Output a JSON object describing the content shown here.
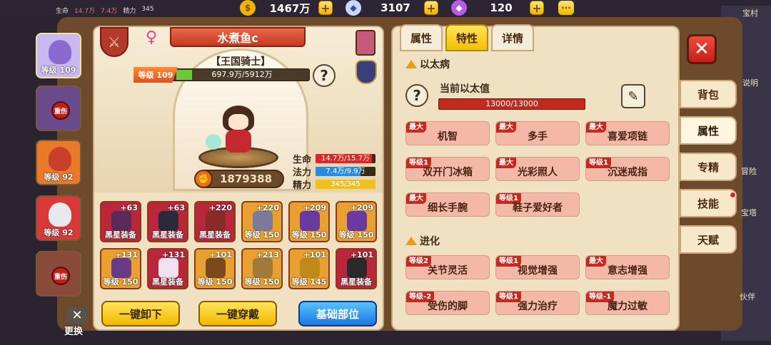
{
  "currency": {
    "gold": "1467万",
    "diamond": "3107",
    "gem": "120",
    "plus_label": "+",
    "more_label": "···",
    "gold_icon": "gold-coin-icon",
    "diamond_icon": "diamond-icon",
    "gem_icon": "purple-gem-icon"
  },
  "peek_stats": {
    "hp_label": "生命",
    "hp": "14.7万",
    "mp": "7.4万",
    "energy_label": "精力",
    "energy": "345"
  },
  "right_edge_texts": [
    "宝村",
    "说明",
    "冒险",
    "宝塔",
    "伙伴"
  ],
  "roster": [
    {
      "level": "等级 109",
      "state": "selected",
      "color": "#c9b8f0"
    },
    {
      "level": "",
      "state": "重伤",
      "color": "#6a4a8a"
    },
    {
      "level": "等级 92",
      "state": "normal",
      "color": "#e87a2a"
    },
    {
      "level": "等级 92",
      "state": "normal",
      "color": "#d83a3a"
    },
    {
      "level": "",
      "state": "重伤",
      "color": "#8a4a3a"
    }
  ],
  "swap_label": "更换",
  "hero": {
    "name": "水煮鱼c",
    "title": "【王国骑士】",
    "level_tag": "等级 109",
    "exp_text": "697.9万/5912万",
    "exp_fraction": 0.118,
    "power": "1879388",
    "help": "?",
    "stats": [
      {
        "label": "生命",
        "value": "14.7万/15.7万",
        "fraction": 0.936,
        "color": "#d8282a"
      },
      {
        "label": "法力",
        "value": "7.4万/9.9万",
        "fraction": 0.747,
        "color": "#2a8ae0"
      },
      {
        "label": "精力",
        "value": "345/345",
        "fraction": 1.0,
        "color": "#f0c020"
      }
    ]
  },
  "equipment": [
    {
      "plus": "+63",
      "label": "黑星装备",
      "bg": "#b8283a",
      "item": "#5a2a5a"
    },
    {
      "plus": "+63",
      "label": "黑星装备",
      "bg": "#b8283a",
      "item": "#2a2a3a"
    },
    {
      "plus": "+220",
      "label": "黑星装备",
      "bg": "#b8283a",
      "item": "#8a2a2a"
    },
    {
      "plus": "+220",
      "label": "等级 150",
      "bg": "#e8a030",
      "item": "#7a7a9a"
    },
    {
      "plus": "+209",
      "label": "等级 150",
      "bg": "#e8a030",
      "item": "#6a3aa0"
    },
    {
      "plus": "+209",
      "label": "等级 150",
      "bg": "#e8a030",
      "item": "#6a3aa0"
    },
    {
      "plus": "+131",
      "label": "等级 150",
      "bg": "#e8a030",
      "item": "#6a3a8a"
    },
    {
      "plus": "+131",
      "label": "黑星装备",
      "bg": "#b8283a",
      "item": "#f0e0f0"
    },
    {
      "plus": "+101",
      "label": "等级 150",
      "bg": "#e8a030",
      "item": "#7a4a1a"
    },
    {
      "plus": "+213",
      "label": "等级 150",
      "bg": "#e8a030",
      "item": "#a07a3a"
    },
    {
      "plus": "+101",
      "label": "等级 145",
      "bg": "#e8a030",
      "item": "#c08a1a"
    },
    {
      "plus": "+101",
      "label": "黑星装备",
      "bg": "#b8283a",
      "item": "#2a2a2a"
    }
  ],
  "buttons": {
    "unequip": "一键卸下",
    "equip": "一键穿戴",
    "base_slot": "基础部位"
  },
  "tabs": [
    "属性",
    "特性",
    "详情"
  ],
  "active_tab": "特性",
  "ether": {
    "section": "以太病",
    "label": "当前以太值",
    "value": "13000/13000",
    "help": "?",
    "edit_icon": "✎"
  },
  "ether_traits": [
    {
      "tag": "最大",
      "name": "机智"
    },
    {
      "tag": "最大",
      "name": "多手"
    },
    {
      "tag": "最大",
      "name": "喜爱项链"
    },
    {
      "tag": "等级1",
      "name": "双开门冰箱"
    },
    {
      "tag": "最大",
      "name": "光彩照人"
    },
    {
      "tag": "等级1",
      "name": "沉迷戒指"
    },
    {
      "tag": "最大",
      "name": "细长手腕"
    },
    {
      "tag": "等级1",
      "name": "鞋子爱好者"
    }
  ],
  "evolution": {
    "section": "进化",
    "traits": [
      {
        "tag": "等级2",
        "name": "关节灵活"
      },
      {
        "tag": "等级1",
        "name": "视觉增强"
      },
      {
        "tag": "最大",
        "name": "意志增强"
      },
      {
        "tag": "等级-2",
        "name": "受伤的脚"
      },
      {
        "tag": "等级1",
        "name": "强力治疗"
      },
      {
        "tag": "等级-1",
        "name": "魔力过敏"
      }
    ]
  },
  "close_label": "✕",
  "side_tabs": [
    {
      "label": "背包",
      "active": false,
      "dot": false
    },
    {
      "label": "属性",
      "active": true,
      "dot": false
    },
    {
      "label": "专精",
      "active": false,
      "dot": false
    },
    {
      "label": "技能",
      "active": false,
      "dot": true
    },
    {
      "label": "天赋",
      "active": false,
      "dot": false
    }
  ]
}
